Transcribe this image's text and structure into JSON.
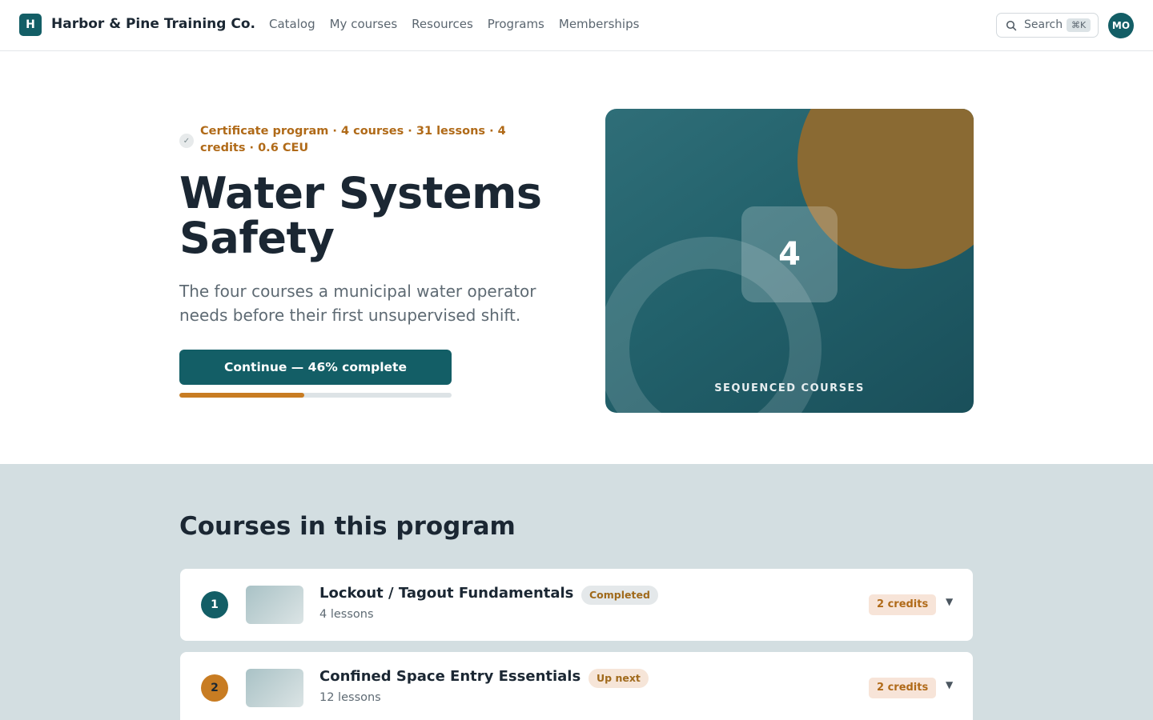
{
  "header": {
    "logo_letter": "H",
    "brand": "Harbor & Pine Training Co.",
    "nav": [
      "Catalog",
      "My courses",
      "Resources",
      "Programs",
      "Memberships"
    ],
    "search_label": "Search",
    "search_shortcut": "⌘K",
    "avatar_initials": "MO"
  },
  "hero": {
    "eyebrow_icon": "✓",
    "eyebrow": "Certificate program · 4 courses · 31 lessons · 4 credits · 0.6 CEU",
    "title": "Water Systems Safety",
    "subtitle": "The four courses a municipal water operator needs before their first unsupervised shift.",
    "cta_label": "Continue — 46% complete",
    "progress_percent": 46,
    "card_number": "4",
    "card_caption": "SEQUENCED COURSES"
  },
  "courses": {
    "title": "Courses in this program",
    "items": [
      {
        "step": "1",
        "name": "Lockout / Tagout Fundamentals",
        "status": "Completed",
        "lessons": "4 lessons",
        "credits": "2 credits"
      },
      {
        "step": "2",
        "name": "Confined Space Entry Essentials",
        "status": "Up next",
        "lessons": "12 lessons",
        "credits": "2 credits"
      }
    ]
  },
  "colors": {
    "primary": "#135e66",
    "accent": "#c87c22",
    "section_bg": "#d3dee1"
  }
}
